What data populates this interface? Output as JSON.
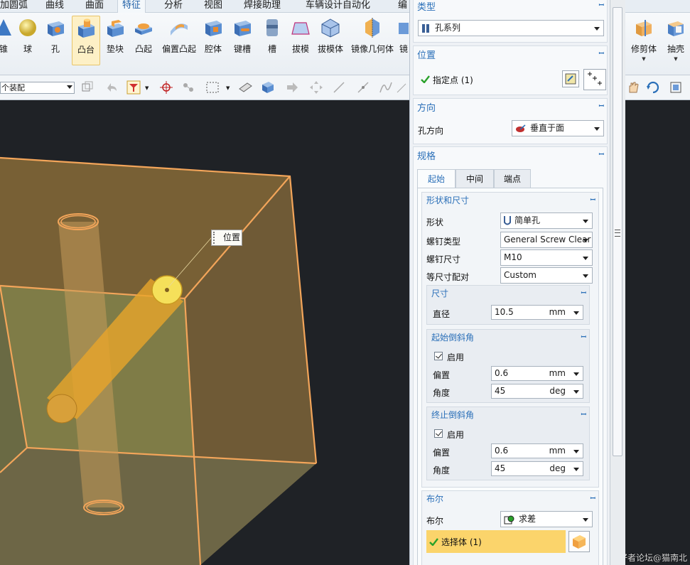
{
  "menu": {
    "tabs": [
      "加圆弧",
      "曲线",
      "曲面",
      "特征",
      "分析",
      "视图",
      "焊接助理",
      "车辆设计自动化",
      "编"
    ],
    "active_tab": "特征"
  },
  "ribbon": {
    "buttons": [
      "锥",
      "球",
      "孔",
      "凸台",
      "垫块",
      "凸起",
      "偏置凸起",
      "腔体",
      "键槽",
      "槽",
      "拔模",
      "拔模体",
      "镜像几何体",
      "镜"
    ],
    "right_buttons": [
      "修剪体",
      "抽壳"
    ],
    "active_button": "凸台"
  },
  "toolbar": {
    "assembly_filter": "个装配"
  },
  "viewport": {
    "callout_label": "位置",
    "watermark": "UG爱好者论坛@猫南北"
  },
  "panel": {
    "type_section": {
      "title": "类型",
      "value": "孔系列"
    },
    "position_section": {
      "title": "位置",
      "specify_point": "指定点 (1)"
    },
    "direction_section": {
      "title": "方向",
      "hole_direction_label": "孔方向",
      "hole_direction_value": "垂直于面"
    },
    "spec_section": {
      "title": "规格",
      "tabs": [
        "起始",
        "中间",
        "端点"
      ],
      "active_tab": "起始",
      "shape_size": {
        "title": "形状和尺寸",
        "shape_label": "形状",
        "shape_value": "简单孔",
        "screw_type_label": "螺钉类型",
        "screw_type_value": "General Screw Clear",
        "screw_size_label": "螺钉尺寸",
        "screw_size_value": "M10",
        "fit_label": "等尺寸配对",
        "fit_value": "Custom"
      },
      "dimensions": {
        "title": "尺寸",
        "diameter_label": "直径",
        "diameter_value": "10.5",
        "diameter_unit": "mm"
      },
      "start_chamfer": {
        "title": "起始倒斜角",
        "enable_label": "启用",
        "enabled": true,
        "offset_label": "偏置",
        "offset_value": "0.6",
        "offset_unit": "mm",
        "angle_label": "角度",
        "angle_value": "45",
        "angle_unit": "deg"
      },
      "end_chamfer": {
        "title": "终止倒斜角",
        "enable_label": "启用",
        "enabled": true,
        "offset_label": "偏置",
        "offset_value": "0.6",
        "offset_unit": "mm",
        "angle_label": "角度",
        "angle_value": "45",
        "angle_unit": "deg"
      },
      "boolean": {
        "title": "布尔",
        "label": "布尔",
        "value": "求差",
        "select_body": "选择体 (1)"
      }
    }
  },
  "colors": {
    "accent_blue": "#2a6fb8",
    "part_orange": "#f3a55a",
    "highlight_yellow": "#fbd46b",
    "check_green": "#2aa12a"
  }
}
